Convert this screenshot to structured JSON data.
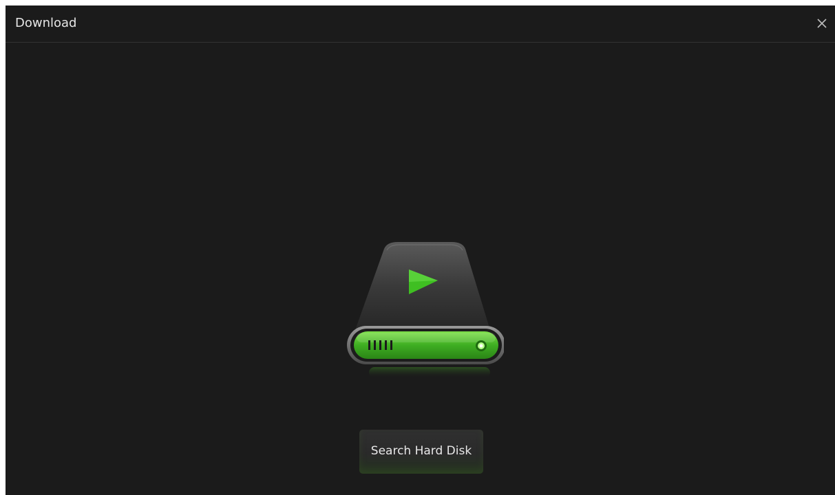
{
  "window": {
    "title": "Download",
    "close_icon": "close-icon"
  },
  "main": {
    "illustration_icon": "hard-disk-icon",
    "search_button_label": "Search Hard Disk"
  },
  "colors": {
    "background": "#1b1b1b",
    "accent_green": "#4cc02c",
    "text": "#e6e6e6"
  }
}
